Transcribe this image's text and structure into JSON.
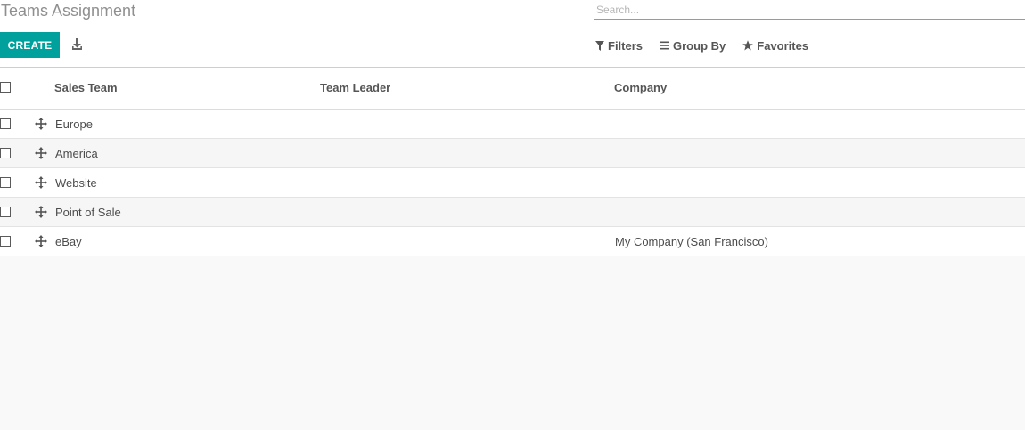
{
  "breadcrumb": {
    "title": "Teams Assignment"
  },
  "search": {
    "placeholder": "Search..."
  },
  "buttons": {
    "create": "CREATE",
    "download_icon": "download-icon"
  },
  "search_options": [
    {
      "label": "Filters",
      "icon": "filter-icon"
    },
    {
      "label": "Group By",
      "icon": "bars-icon"
    },
    {
      "label": "Favorites",
      "icon": "star-icon"
    }
  ],
  "table": {
    "columns": [
      "Sales Team",
      "Team Leader",
      "Company"
    ],
    "rows": [
      {
        "name": "Europe",
        "leader": "",
        "company": ""
      },
      {
        "name": "America",
        "leader": "",
        "company": ""
      },
      {
        "name": "Website",
        "leader": "",
        "company": ""
      },
      {
        "name": "Point of Sale",
        "leader": "",
        "company": ""
      },
      {
        "name": "eBay",
        "leader": "",
        "company": "My Company (San Francisco)"
      }
    ]
  },
  "colors": {
    "accent": "#00a09d",
    "background": "#f9f9f9"
  }
}
